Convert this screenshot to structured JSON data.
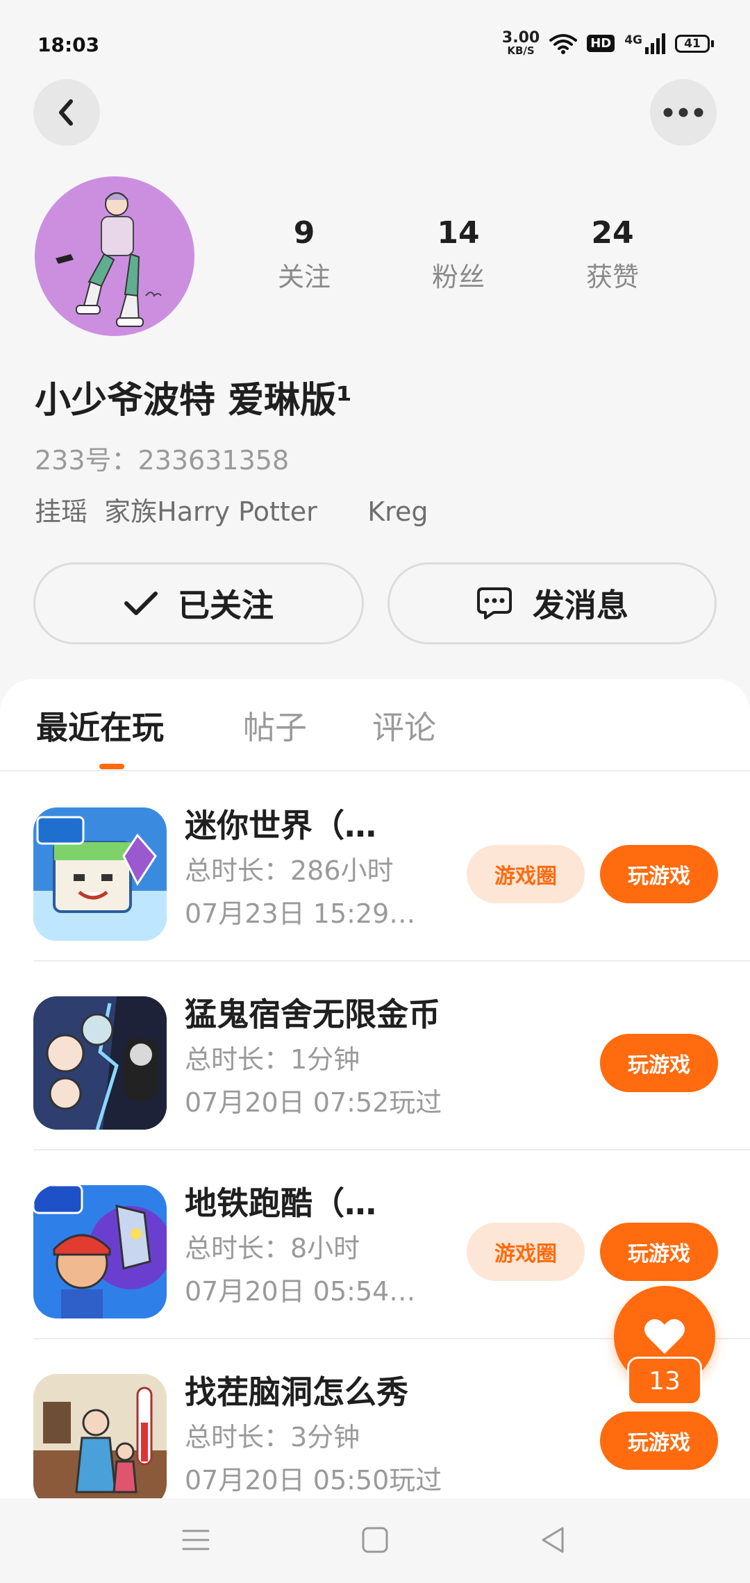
{
  "status_bar": {
    "time": "18:03",
    "speed_value": "3.00",
    "speed_unit": "KB/S",
    "hd": "HD",
    "network": "4G",
    "battery": "41"
  },
  "header": {
    "back_icon": "chevron-left-icon",
    "more_icon": "more-dots-icon"
  },
  "profile": {
    "avatar_icon": "user-avatar",
    "stats": [
      {
        "value": "9",
        "label": "关注"
      },
      {
        "value": "14",
        "label": "粉丝"
      },
      {
        "value": "24",
        "label": "获赞"
      }
    ],
    "name": "小少爷波特 爱琳版¹",
    "id_text": "233号：233631358",
    "bio": "挂瑶  家族Harry Potter      Kreg"
  },
  "actions": {
    "follow_label": "已关注",
    "message_label": "发消息"
  },
  "tabs": [
    {
      "label": "最近在玩",
      "active": true
    },
    {
      "label": "帖子",
      "active": false
    },
    {
      "label": "评论",
      "active": false
    }
  ],
  "games": [
    {
      "title": "迷你世界（…",
      "duration": "总时长：286小时",
      "date": "07月23日 15:29…",
      "circle_label": "游戏圈",
      "play_label": "玩游戏"
    },
    {
      "title": "猛鬼宿舍无限金币",
      "duration": "总时长：1分钟",
      "date": "07月20日 07:52玩过",
      "circle_label": "",
      "play_label": "玩游戏"
    },
    {
      "title": "地铁跑酷（…",
      "duration": "总时长：8小时",
      "date": "07月20日 05:54…",
      "circle_label": "游戏圈",
      "play_label": "玩游戏"
    },
    {
      "title": "找茬脑洞怎么秀",
      "duration": "总时长：3分钟",
      "date": "07月20日 05:50玩过",
      "circle_label": "",
      "play_label": "玩游戏"
    }
  ],
  "like": {
    "count": "13"
  },
  "colors": {
    "accent": "#ff6b0e",
    "accent_light": "#fde6d6",
    "avatar_bg": "#cc8fe0"
  }
}
